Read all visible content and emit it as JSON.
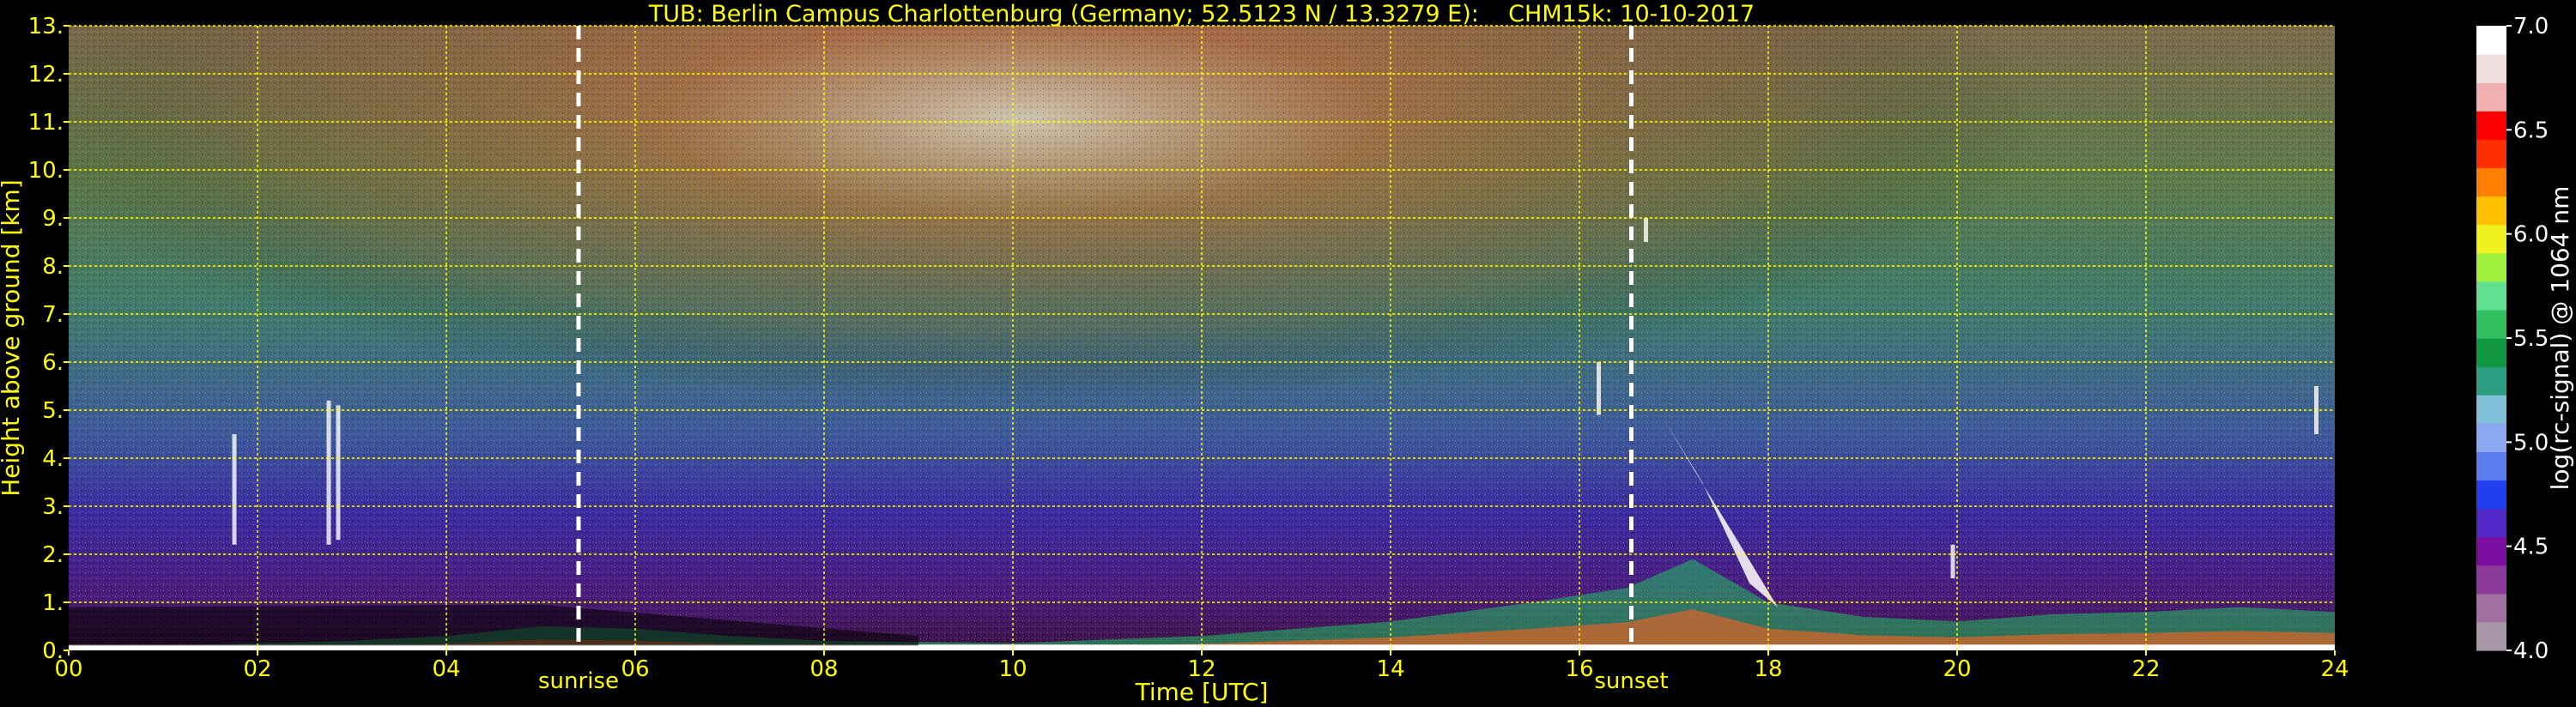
{
  "chart_data": {
    "type": "heatmap",
    "title": "TUB: Berlin Campus Charlottenburg (Germany; 52.5123 N / 13.3279 E):    CHM15k: 10-10-2017",
    "xlabel": "Time [UTC]",
    "ylabel": "Height above ground [km]",
    "xlim": [
      0,
      24
    ],
    "ylim": [
      0,
      13
    ],
    "x_ticks": [
      0,
      2,
      4,
      6,
      8,
      10,
      12,
      14,
      16,
      18,
      20,
      22,
      24
    ],
    "x_tick_labels": [
      "00",
      "02",
      "04",
      "06",
      "08",
      "10",
      "12",
      "14",
      "16",
      "18",
      "20",
      "22",
      "24"
    ],
    "y_ticks": [
      0,
      1,
      2,
      3,
      4,
      5,
      6,
      7,
      8,
      9,
      10,
      11,
      12,
      13
    ],
    "y_tick_labels": [
      "0.",
      "1.",
      "2.",
      "3.",
      "4.",
      "5.",
      "6.",
      "7.",
      "8.",
      "9.",
      "10.",
      "11.",
      "12.",
      "13."
    ],
    "grid": true,
    "annotations": [
      {
        "label": "sunrise",
        "x": 5.4
      },
      {
        "label": "sunset",
        "x": 16.55
      }
    ],
    "colorbar": {
      "label": "log(rc-signal) @ 1064 nm",
      "range": [
        4.0,
        7.0
      ],
      "tick_values": [
        4.0,
        4.5,
        5.0,
        5.5,
        6.0,
        6.5,
        7.0
      ],
      "tick_labels": [
        "4.0",
        "4.5",
        "5.0",
        "5.5",
        "6.0",
        "6.5",
        "7.0"
      ],
      "colors": [
        "#a898a8",
        "#a070a0",
        "#8a3a9a",
        "#7a10a0",
        "#5028c8",
        "#2040f0",
        "#5a7cf0",
        "#8aa8f0",
        "#80c0d8",
        "#2aa080",
        "#109840",
        "#30c060",
        "#60e090",
        "#a0f040",
        "#f0f020",
        "#ffc000",
        "#ff8000",
        "#ff3000",
        "#ff0000",
        "#f0b0b0",
        "#f0e0e0",
        "#ffffff"
      ]
    }
  }
}
